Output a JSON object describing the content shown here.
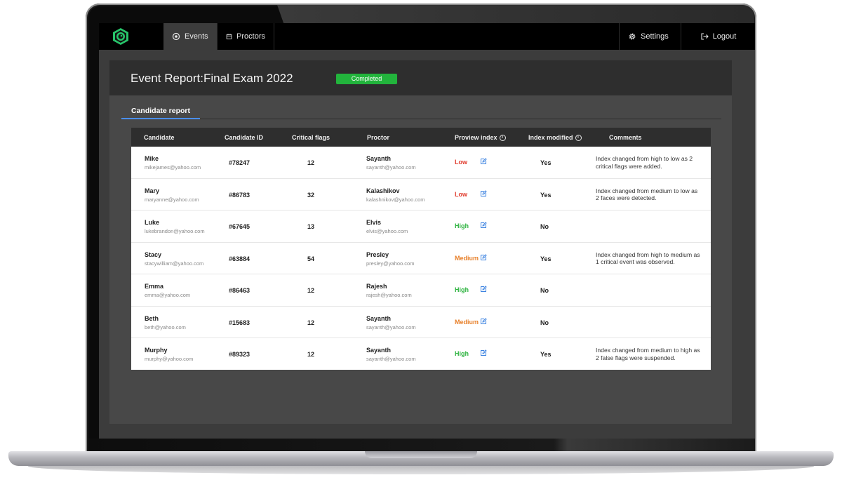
{
  "nav": {
    "events_label": "Events",
    "proctors_label": "Proctors",
    "settings_label": "Settings",
    "logout_label": "Logout"
  },
  "report": {
    "label": "Event Report:",
    "title": "Final Exam 2022",
    "status": "Completed",
    "status_color": "#22b43c"
  },
  "tabs": [
    {
      "label": "Candidate report",
      "active": true
    }
  ],
  "table": {
    "columns": [
      "Candidate",
      "Candidate ID",
      "Critical flags",
      "Proctor",
      "Proview index",
      "Index modified",
      "Comments"
    ],
    "rows": [
      {
        "name": "Mike",
        "email": "mikejames@yahoo.com",
        "id": "#78247",
        "flags": "12",
        "proctor": "Sayanth",
        "proctor_email": "sayanth@yahoo.com",
        "index": "Low",
        "modified": "Yes",
        "comment": "Index changed from high to low as 2 critical flags were added."
      },
      {
        "name": "Mary",
        "email": "maryanne@yahoo.com",
        "id": "#86783",
        "flags": "32",
        "proctor": "Kalashikov",
        "proctor_email": "kalashnikov@yahoo.com",
        "index": "Low",
        "modified": "Yes",
        "comment": "Index changed from medium to low as 2 faces were detected."
      },
      {
        "name": "Luke",
        "email": "lukebrandon@yahoo.com",
        "id": "#67645",
        "flags": "13",
        "proctor": "Elvis",
        "proctor_email": "elvis@yahoo.com",
        "index": "High",
        "modified": "No",
        "comment": ""
      },
      {
        "name": "Stacy",
        "email": "stacywilliam@yahoo.com",
        "id": "#63884",
        "flags": "54",
        "proctor": "Presley",
        "proctor_email": "presley@yahoo.com",
        "index": "Medium",
        "modified": "Yes",
        "comment": "Index changed from high to medium as 1 critical event was observed."
      },
      {
        "name": "Emma",
        "email": "emma@yahoo.com",
        "id": "#86463",
        "flags": "12",
        "proctor": "Rajesh",
        "proctor_email": "rajesh@yahoo.com",
        "index": "High",
        "modified": "No",
        "comment": ""
      },
      {
        "name": "Beth",
        "email": "beth@yahoo.com",
        "id": "#15683",
        "flags": "12",
        "proctor": "Sayanth",
        "proctor_email": "sayanth@yahoo.com",
        "index": "Medium",
        "modified": "No",
        "comment": ""
      },
      {
        "name": "Murphy",
        "email": "murphy@yahoo.com",
        "id": "#89323",
        "flags": "12",
        "proctor": "Sayanth",
        "proctor_email": "sayanth@yahoo.com",
        "index": "High",
        "modified": "Yes",
        "comment": "Index changed from medium to high as 2 false flags were suspended."
      }
    ]
  },
  "colors": {
    "index_low": "#e03b2d",
    "index_high": "#2db33f",
    "index_medium": "#e8802a",
    "accent": "#4a8ff0"
  },
  "icons": [
    "logo-icon",
    "events-icon",
    "calendar-icon",
    "gear-icon",
    "logout-icon",
    "info-icon",
    "edit-icon"
  ]
}
